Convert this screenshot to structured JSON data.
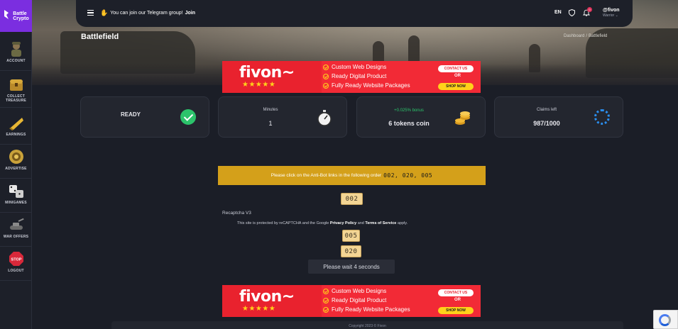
{
  "brand": {
    "line1": "Battle",
    "line2": "Crypto",
    "color": "#7b2ee0"
  },
  "sidebar": {
    "items": [
      {
        "label": "ACCOUNT",
        "icon": "soldier-icon"
      },
      {
        "label": "COLLECT TREASURE",
        "icon": "treasure-icon"
      },
      {
        "label": "EARNINGS",
        "icon": "gold-bar-icon"
      },
      {
        "label": "ADVERTISE",
        "icon": "medal-icon"
      },
      {
        "label": "MINIGAMES",
        "icon": "dice-icon"
      },
      {
        "label": "WAR OFFERS",
        "icon": "tank-icon"
      },
      {
        "label": "LOGOUT",
        "icon": "stop-sign-icon"
      }
    ]
  },
  "topbar": {
    "announcement": "You can join our Telegram group!",
    "join_label": "Join",
    "language": "EN",
    "notification_count": "0",
    "user": {
      "name": "@fivon",
      "role": "Warrior"
    }
  },
  "page": {
    "title": "Battlefield",
    "breadcrumb": [
      "Dashboard",
      "Battlefield"
    ]
  },
  "ad": {
    "brand": "fivon~",
    "stars": "★★★★★",
    "lines": [
      "Custom Web Designs",
      "Ready Digital Product",
      "Fully Ready Website Packages"
    ],
    "contact_label": "CONTACT US",
    "or_label": "OR",
    "shop_label": "SHOP NOW"
  },
  "stats": {
    "status": "READY",
    "minutes_label": "Minutes",
    "minutes_value": "1",
    "bonus": "+0.025% bonus",
    "reward": "6 tokens coin",
    "claims_label": "Claims left",
    "claims_value": "987/1000"
  },
  "antibot": {
    "instruction": "Please click on the Anti-Bot links in the following order",
    "order": "002, 020, 005",
    "links": [
      "002",
      "005",
      "020"
    ]
  },
  "recaptcha": {
    "title": "Recaptcha V3",
    "note_prefix": "This site is protected by reCAPTCHA and the Google",
    "privacy": "Privacy Policy",
    "and": "and",
    "terms": "Terms of Service",
    "suffix": "apply."
  },
  "wait_label": "Please wait 4 seconds",
  "footer": {
    "text": "Copyright 2023 © Fivon"
  }
}
